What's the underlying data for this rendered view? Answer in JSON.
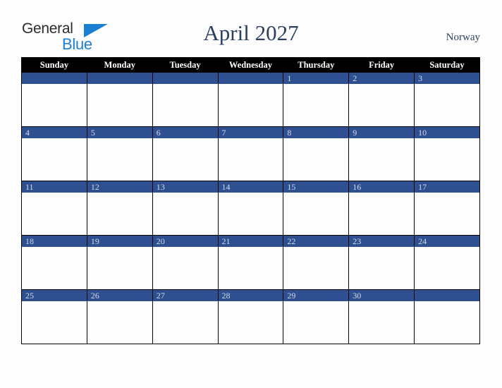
{
  "logo": {
    "name_part1": "General",
    "name_part2": "Blue",
    "triangle_icon": "triangle-icon",
    "color_dark": "#2b2b2b",
    "color_blue": "#1b7fd4"
  },
  "header": {
    "title": "April 2027",
    "country": "Norway",
    "title_color": "#2b3f62"
  },
  "calendar": {
    "month": "April",
    "year": "2027",
    "accent_color": "#2e5090",
    "header_bg": "#000000",
    "day_number_color": "#d3dbe8",
    "weekdays": [
      "Sunday",
      "Monday",
      "Tuesday",
      "Wednesday",
      "Thursday",
      "Friday",
      "Saturday"
    ],
    "weeks": [
      [
        {
          "day": ""
        },
        {
          "day": ""
        },
        {
          "day": ""
        },
        {
          "day": ""
        },
        {
          "day": "1"
        },
        {
          "day": "2"
        },
        {
          "day": "3"
        }
      ],
      [
        {
          "day": "4"
        },
        {
          "day": "5"
        },
        {
          "day": "6"
        },
        {
          "day": "7"
        },
        {
          "day": "8"
        },
        {
          "day": "9"
        },
        {
          "day": "10"
        }
      ],
      [
        {
          "day": "11"
        },
        {
          "day": "12"
        },
        {
          "day": "13"
        },
        {
          "day": "14"
        },
        {
          "day": "15"
        },
        {
          "day": "16"
        },
        {
          "day": "17"
        }
      ],
      [
        {
          "day": "18"
        },
        {
          "day": "19"
        },
        {
          "day": "20"
        },
        {
          "day": "21"
        },
        {
          "day": "22"
        },
        {
          "day": "23"
        },
        {
          "day": "24"
        }
      ],
      [
        {
          "day": "25"
        },
        {
          "day": "26"
        },
        {
          "day": "27"
        },
        {
          "day": "28"
        },
        {
          "day": "29"
        },
        {
          "day": "30"
        },
        {
          "day": ""
        }
      ]
    ]
  }
}
